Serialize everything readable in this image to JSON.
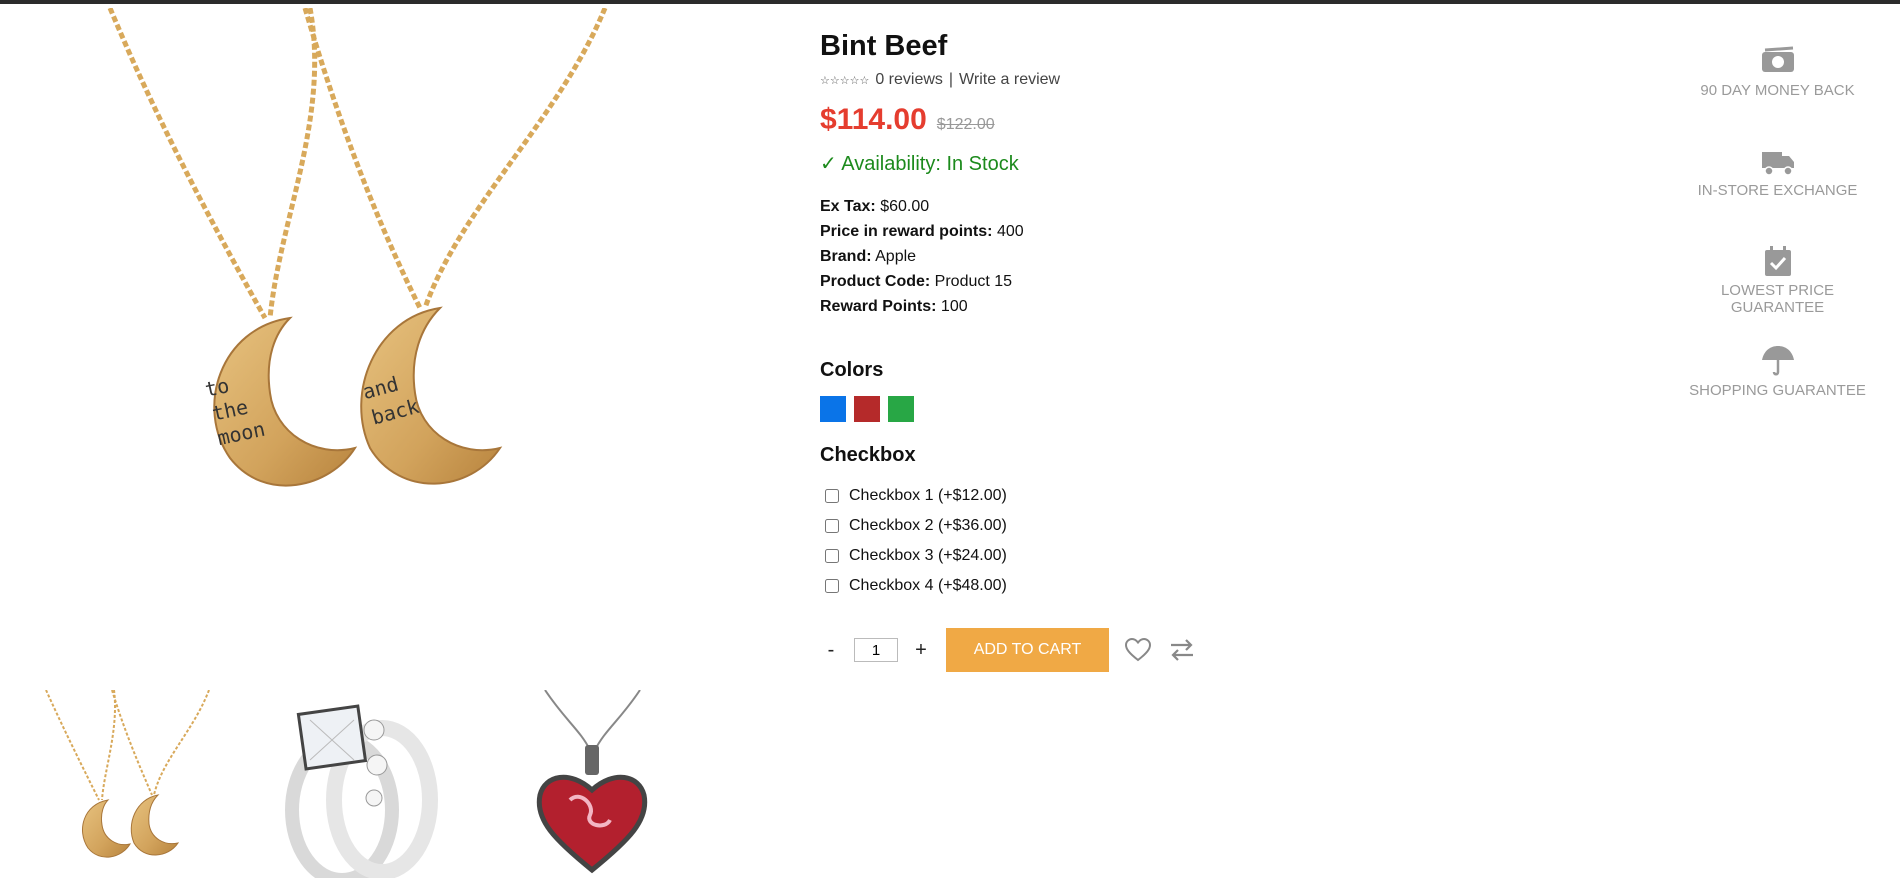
{
  "product": {
    "title": "Bint Beef",
    "stars": "☆☆☆☆☆",
    "reviews_text": "0 reviews",
    "separator": "|",
    "write_review": "Write a review",
    "price_new": "$114.00",
    "price_old": "$122.00",
    "availability": "✓ Availability: In Stock",
    "attributes": [
      {
        "label": "Ex Tax:",
        "value": "$60.00"
      },
      {
        "label": "Price in reward points:",
        "value": "400"
      },
      {
        "label": "Brand:",
        "value": "Apple"
      },
      {
        "label": "Product Code:",
        "value": "Product 15"
      },
      {
        "label": "Reward Points:",
        "value": "100"
      }
    ]
  },
  "colors": {
    "title": "Colors",
    "swatches": [
      "#0a74e8",
      "#b52a2a",
      "#28a745"
    ]
  },
  "checkbox": {
    "title": "Checkbox",
    "options": [
      "Checkbox 1 (+$12.00)",
      "Checkbox 2 (+$36.00)",
      "Checkbox 3 (+$24.00)",
      "Checkbox 4 (+$48.00)"
    ]
  },
  "cart": {
    "minus": "-",
    "plus": "+",
    "quantity": "1",
    "add_to_cart": "ADD TO CART"
  },
  "guarantees": [
    {
      "icon": "money-icon",
      "label": "90 DAY MONEY BACK"
    },
    {
      "icon": "truck-icon",
      "label": "IN-STORE EXCHANGE"
    },
    {
      "icon": "calendar-check-icon",
      "label": "LOWEST PRICE GUARANTEE"
    },
    {
      "icon": "umbrella-icon",
      "label": "SHOPPING GUARANTEE"
    }
  ],
  "main_image_engravings": {
    "left": "to the moon",
    "right": "and back"
  },
  "images": [
    "moon-necklace",
    "diamond-rings",
    "heart-pendant"
  ],
  "colors_palette": {
    "accent": "#f0a945",
    "price": "#e53d2f",
    "stock": "#1c8a1c",
    "muted": "#9a9a9a"
  }
}
